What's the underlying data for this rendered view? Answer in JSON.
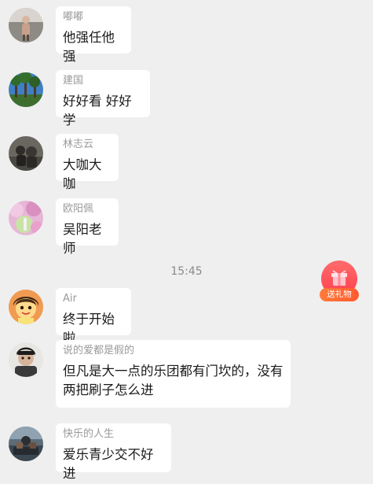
{
  "messages": [
    {
      "sender": "嘟嘟",
      "text": "他强任他强",
      "avatar": "avatar-dudu"
    },
    {
      "sender": "建国",
      "text": "好好看 好好学",
      "avatar": "avatar-jianguo"
    },
    {
      "sender": "林志云",
      "text": "大咖大咖",
      "avatar": "avatar-linzhiyun"
    },
    {
      "sender": "欧阳佩",
      "text": "吴阳老师",
      "avatar": "avatar-ouyangpei"
    },
    {
      "sender": "Air",
      "text": "终于开始啦",
      "avatar": "avatar-air"
    },
    {
      "sender": "说的爱都是假的",
      "text": "但凡是大一点的乐团都有门坎的，没有\n两把刷子怎么进",
      "avatar": "avatar-shuodeai"
    },
    {
      "sender": "快乐的人生",
      "text": "爱乐青少交不好进",
      "avatar": "avatar-kuaile"
    }
  ],
  "timestamp": "15:45",
  "gift_button": {
    "label": "送礼物",
    "icon": "gift-box-icon"
  },
  "colors": {
    "background": "#efefef",
    "bubble": "#ffffff",
    "sender_name": "#9a9a9a",
    "message_text": "#1a1a1a",
    "gift_accent": "#ff4f5e"
  }
}
